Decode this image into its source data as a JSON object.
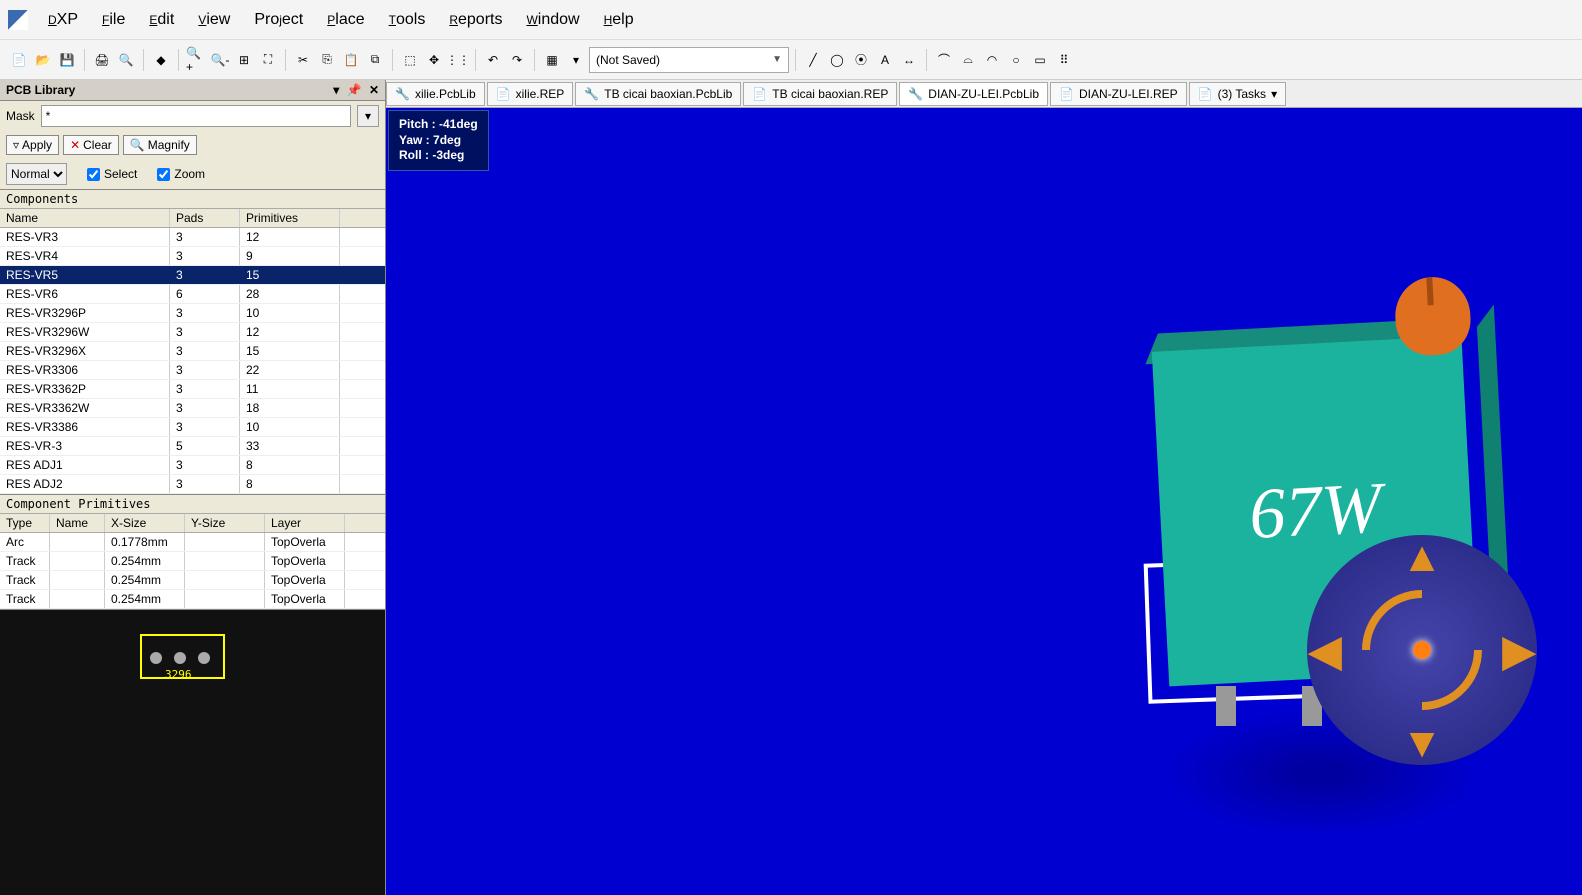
{
  "menu": {
    "app": "DXP",
    "items": [
      "File",
      "Edit",
      "View",
      "Project",
      "Place",
      "Tools",
      "Reports",
      "Window",
      "Help"
    ]
  },
  "toolbar": {
    "saved": "(Not Saved)"
  },
  "panel": {
    "title": "PCB Library",
    "mask_label": "Mask",
    "mask_value": "*",
    "apply": "Apply",
    "clear": "Clear",
    "magnify": "Magnify",
    "mode": "Normal",
    "select": "Select",
    "zoom": "Zoom"
  },
  "components": {
    "title": "Components",
    "cols": [
      "Name",
      "Pads",
      "Primitives"
    ],
    "rows": [
      {
        "name": "RES-VR3",
        "pads": "3",
        "prim": "12"
      },
      {
        "name": "RES-VR4",
        "pads": "3",
        "prim": "9"
      },
      {
        "name": "RES-VR5",
        "pads": "3",
        "prim": "15"
      },
      {
        "name": "RES-VR6",
        "pads": "6",
        "prim": "28"
      },
      {
        "name": "RES-VR3296P",
        "pads": "3",
        "prim": "10"
      },
      {
        "name": "RES-VR3296W",
        "pads": "3",
        "prim": "12"
      },
      {
        "name": "RES-VR3296X",
        "pads": "3",
        "prim": "15"
      },
      {
        "name": "RES-VR3306",
        "pads": "3",
        "prim": "22"
      },
      {
        "name": "RES-VR3362P",
        "pads": "3",
        "prim": "11"
      },
      {
        "name": "RES-VR3362W",
        "pads": "3",
        "prim": "18"
      },
      {
        "name": "RES-VR3386",
        "pads": "3",
        "prim": "10"
      },
      {
        "name": "RES-VR-3",
        "pads": "5",
        "prim": "33"
      },
      {
        "name": "RES ADJ1",
        "pads": "3",
        "prim": "8"
      },
      {
        "name": "RES ADJ2",
        "pads": "3",
        "prim": "8"
      }
    ],
    "selected": 2
  },
  "primitives": {
    "title": "Component Primitives",
    "cols": [
      "Type",
      "Name",
      "X-Size",
      "Y-Size",
      "Layer"
    ],
    "rows": [
      {
        "type": "Arc",
        "name": "",
        "x": "0.1778mm",
        "y": "",
        "layer": "TopOverla"
      },
      {
        "type": "Track",
        "name": "",
        "x": "0.254mm",
        "y": "",
        "layer": "TopOverla"
      },
      {
        "type": "Track",
        "name": "",
        "x": "0.254mm",
        "y": "",
        "layer": "TopOverla"
      },
      {
        "type": "Track",
        "name": "",
        "x": "0.254mm",
        "y": "",
        "layer": "TopOverla"
      }
    ]
  },
  "footprint_label": "3296",
  "tabs": [
    {
      "icon": "pcb",
      "label": "xilie.PcbLib"
    },
    {
      "icon": "rep",
      "label": "xilie.REP"
    },
    {
      "icon": "pcb",
      "label": "TB cicai baoxian.PcbLib"
    },
    {
      "icon": "rep",
      "label": "TB cicai baoxian.REP"
    },
    {
      "icon": "pcb",
      "label": "DIAN-ZU-LEI.PcbLib"
    },
    {
      "icon": "rep",
      "label": "DIAN-ZU-LEI.REP"
    },
    {
      "icon": "rep",
      "label": "(3) Tasks"
    }
  ],
  "active_tab": 4,
  "hud": {
    "pitch": "Pitch : -41deg",
    "yaw": "Yaw : 7deg",
    "roll": "Roll : -3deg"
  },
  "model_text": "67W"
}
